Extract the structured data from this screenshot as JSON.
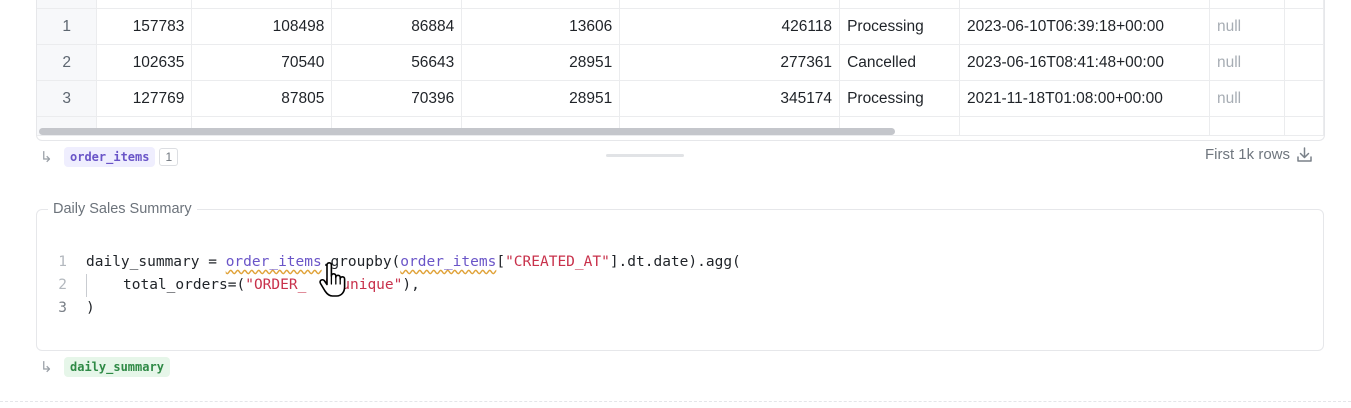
{
  "table": {
    "rows": [
      {
        "idx": "1",
        "c1": "157783",
        "c2": "108498",
        "c3": "86884",
        "c4": "13606",
        "c5": "426118",
        "status": "Processing",
        "created": "2023-06-10T06:39:18+00:00",
        "last": "null"
      },
      {
        "idx": "2",
        "c1": "102635",
        "c2": "70540",
        "c3": "56643",
        "c4": "28951",
        "c5": "277361",
        "status": "Cancelled",
        "created": "2023-06-16T08:41:48+00:00",
        "last": "null"
      },
      {
        "idx": "3",
        "c1": "127769",
        "c2": "87805",
        "c3": "70396",
        "c4": "28951",
        "c5": "345174",
        "status": "Processing",
        "created": "2021-11-18T01:08:00+00:00",
        "last": "null"
      }
    ]
  },
  "output1": {
    "arrow": "↳",
    "variable": "order_items",
    "count": "1"
  },
  "first_rows": {
    "label": "First 1k rows",
    "icon": "download-icon"
  },
  "cell": {
    "title": "Daily Sales Summary",
    "lines": [
      {
        "n": "1",
        "p1": "daily_summary = ",
        "v1": "order_items",
        "p2": ".groupby(",
        "v2": "order_items",
        "p3": "[",
        "s1": "\"CREATED_AT\"",
        "p4": "].dt.date).agg("
      },
      {
        "n": "2",
        "p1": "total_orders=(",
        "s1": "\"ORDER_",
        "p2": "  ",
        "s2": "\"nunique\"",
        "p3": "),"
      },
      {
        "n": "3",
        "p1": ")"
      }
    ]
  },
  "output2": {
    "arrow": "↳",
    "variable": "daily_summary"
  },
  "colors": {
    "accent": "#6a55c8",
    "string": "#c8314b",
    "green_chip": "#2f8a46"
  }
}
